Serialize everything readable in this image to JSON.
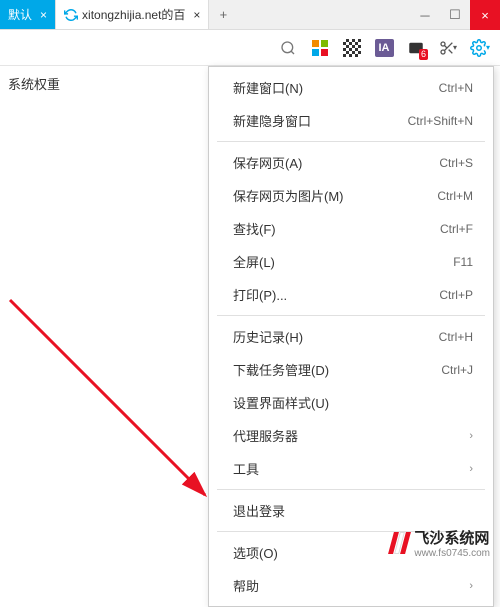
{
  "tabs": {
    "active": {
      "label": "默认"
    },
    "inactive": {
      "label": "xitongzhijia.net的百"
    }
  },
  "sidebar": {
    "text": "系统权重"
  },
  "toolbar": {
    "ia_label": "IA",
    "badge": "6"
  },
  "menu": {
    "items": [
      {
        "label": "新建窗口(N)",
        "shortcut": "Ctrl+N"
      },
      {
        "label": "新建隐身窗口",
        "shortcut": "Ctrl+Shift+N"
      }
    ],
    "items2": [
      {
        "label": "保存网页(A)",
        "shortcut": "Ctrl+S"
      },
      {
        "label": "保存网页为图片(M)",
        "shortcut": "Ctrl+M"
      },
      {
        "label": "查找(F)",
        "shortcut": "Ctrl+F"
      },
      {
        "label": "全屏(L)",
        "shortcut": "F11"
      },
      {
        "label": "打印(P)...",
        "shortcut": "Ctrl+P"
      }
    ],
    "items3": [
      {
        "label": "历史记录(H)",
        "shortcut": "Ctrl+H"
      },
      {
        "label": "下载任务管理(D)",
        "shortcut": "Ctrl+J"
      },
      {
        "label": "设置界面样式(U)",
        "shortcut": ""
      },
      {
        "label": "代理服务器",
        "shortcut": "",
        "submenu": true
      },
      {
        "label": "工具",
        "shortcut": "",
        "submenu": true
      }
    ],
    "items4": [
      {
        "label": "退出登录",
        "shortcut": ""
      }
    ],
    "items5": [
      {
        "label": "选项(O)",
        "shortcut": ""
      },
      {
        "label": "帮助",
        "shortcut": "",
        "submenu": true
      }
    ]
  },
  "watermark": {
    "title": "飞沙系统网",
    "url": "www.fs0745.com"
  }
}
